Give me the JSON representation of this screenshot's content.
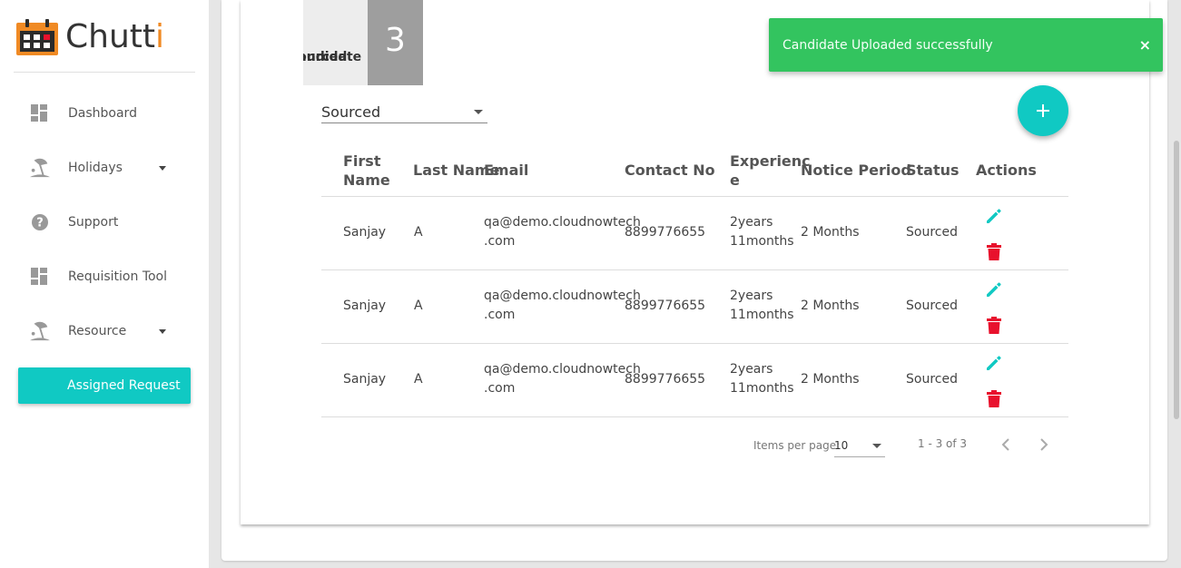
{
  "brand": {
    "name_main": "Chutt",
    "name_accent": "i",
    "accent_color": "#f08a24"
  },
  "sidebar": {
    "items": [
      {
        "label": "Dashboard",
        "icon": "dashboard-icon"
      },
      {
        "label": "Holidays",
        "icon": "beach-icon",
        "has_submenu": true
      },
      {
        "label": "Support",
        "icon": "help-icon"
      },
      {
        "label": "Requisition Tool",
        "icon": "dashboard-icon"
      },
      {
        "label": "Resource",
        "icon": "beach-icon",
        "has_submenu": true
      },
      {
        "label": "Assigned Request",
        "active": true
      }
    ],
    "active_color": "#10c9c3"
  },
  "summary": {
    "label_line1": "Sourced",
    "label_line2": "Candidate",
    "count": "3"
  },
  "filter": {
    "status_value": "Sourced"
  },
  "table": {
    "headers": {
      "first_name_l1": "First",
      "first_name_l2": "Name",
      "last_name": "Last Name",
      "email": "Email",
      "contact": "Contact No",
      "experience_l1": "Experienc",
      "experience_l2": "e",
      "notice": "Notice Period",
      "status": "Status",
      "actions": "Actions"
    },
    "rows": [
      {
        "first_name": "Sanjay",
        "last_name": "A",
        "email_l1": "qa@demo.cloudnowtech",
        "email_l2": ".com",
        "contact": "8899776655",
        "exp_l1": "2years",
        "exp_l2": "11months",
        "notice": "2 Months",
        "status": "Sourced"
      },
      {
        "first_name": "Sanjay",
        "last_name": "A",
        "email_l1": "qa@demo.cloudnowtech",
        "email_l2": ".com",
        "contact": "8899776655",
        "exp_l1": "2years",
        "exp_l2": "11months",
        "notice": "2 Months",
        "status": "Sourced"
      },
      {
        "first_name": "Sanjay",
        "last_name": "A",
        "email_l1": "qa@demo.cloudnowtech",
        "email_l2": ".com",
        "contact": "8899776655",
        "exp_l1": "2years",
        "exp_l2": "11months",
        "notice": "2 Months",
        "status": "Sourced"
      }
    ],
    "edit_icon_color": "#10c9c3",
    "delete_icon_color": "#e8112d"
  },
  "paginator": {
    "items_per_page_label": "Items per page:",
    "page_size": "10",
    "range": "1 - 3 of 3"
  },
  "toast": {
    "message": "Candidate Uploaded successfully",
    "close_label": "×",
    "color": "#33c45f"
  }
}
